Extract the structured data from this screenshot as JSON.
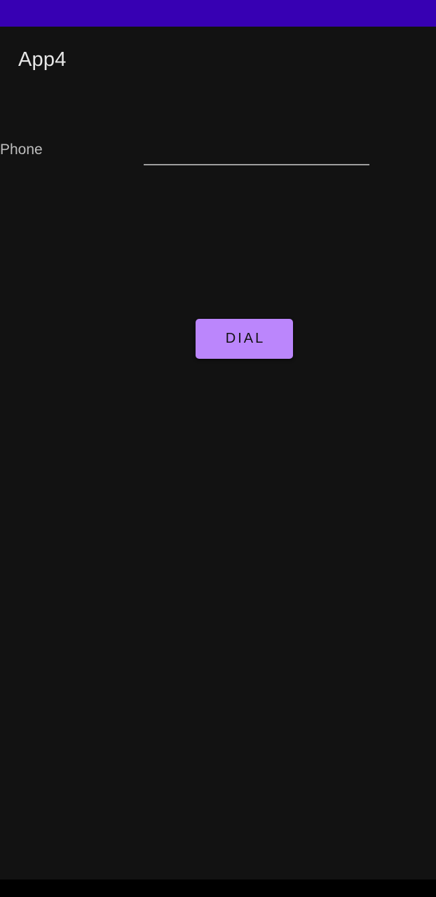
{
  "colors": {
    "status_bar": "#3700B3",
    "background": "#121212",
    "button": "#BB86FC",
    "button_text": "#121212",
    "nav_bar": "#000000"
  },
  "app_bar": {
    "title": "App4"
  },
  "form": {
    "phone_label": "Phone",
    "phone_value": "",
    "dial_label": "DIAL"
  }
}
